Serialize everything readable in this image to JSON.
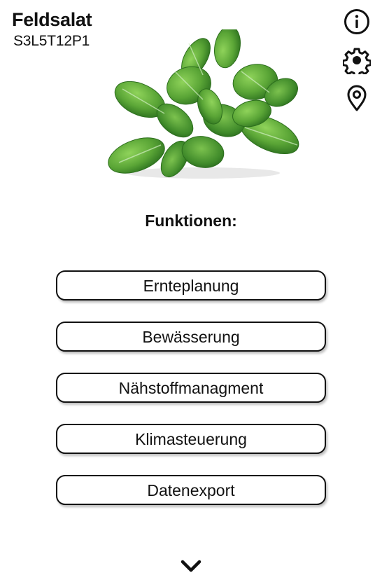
{
  "header": {
    "title": "Feldsalat",
    "subtitle": "S3L5T12P1"
  },
  "icons": {
    "info": "info-icon",
    "settings": "gear-icon",
    "location": "location-pin-icon",
    "more": "chevron-down-icon"
  },
  "image": {
    "subject": "lamb's lettuce plant"
  },
  "main": {
    "heading": "Funktionen:",
    "buttons": [
      {
        "label": "Ernteplanung"
      },
      {
        "label": "Bewässerung"
      },
      {
        "label": "Nähstoffmanagment"
      },
      {
        "label": "Klimasteuerung"
      },
      {
        "label": "Datenexport"
      }
    ]
  },
  "colors": {
    "text": "#111111",
    "background": "#ffffff",
    "leaf_dark": "#3f8a2a",
    "leaf_light": "#7cc24e"
  }
}
